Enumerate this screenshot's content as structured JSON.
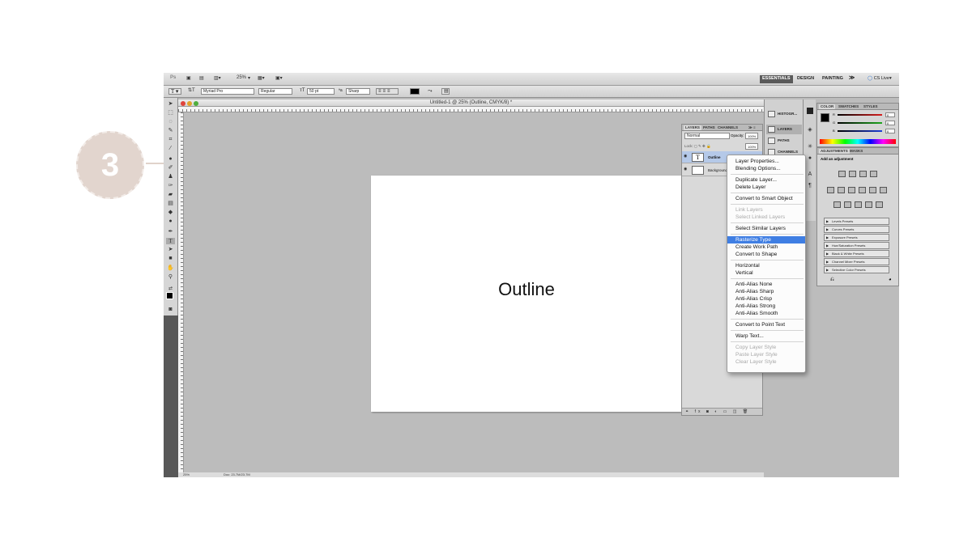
{
  "step": {
    "number": "3"
  },
  "appbar": {
    "app_logo": "Ps",
    "zoom": "25%",
    "workspaces": [
      "ESSENTIALS",
      "DESIGN",
      "PAINTING"
    ],
    "more": "≫",
    "cs_live": "CS Live"
  },
  "options_bar": {
    "font_family": "Myriad Pro",
    "font_style": "Regular",
    "font_size": "50 pt",
    "anti_alias": "Sharp"
  },
  "document": {
    "title": "Untitled-1 @ 25% (Outline, CMYK/8) *",
    "canvas_text": "Outline",
    "status_zoom": "25%",
    "status_doc": "Doc: 23.7M/23.7M"
  },
  "layers_panel": {
    "tabs": [
      "LAYERS",
      "PATHS",
      "CHANNELS"
    ],
    "blend_mode": "Normal",
    "opacity_label": "Opacity:",
    "opacity_value": "100%",
    "fill_value": "100%",
    "layers": [
      {
        "name": "Outline",
        "thumb": "T",
        "selected": true
      },
      {
        "name": "Background",
        "thumb": "",
        "selected": false
      }
    ]
  },
  "dock": {
    "items": [
      "HISTOGR...",
      "LAYERS",
      "PATHS",
      "CHANNELS"
    ]
  },
  "color_panel": {
    "tabs": [
      "COLOR",
      "SWATCHES",
      "STYLES"
    ],
    "channels": [
      {
        "label": "R",
        "value": "0",
        "color": "#d81e1e"
      },
      {
        "label": "G",
        "value": "0",
        "color": "#1ea81e"
      },
      {
        "label": "B",
        "value": "0",
        "color": "#1e3ed8"
      }
    ]
  },
  "adjustments_panel": {
    "tabs": [
      "ADJUSTMENTS",
      "MASKS"
    ],
    "heading": "Add an adjustment",
    "presets": [
      "Levels Presets",
      "Curves Presets",
      "Exposure Presets",
      "Hue/Saturation Presets",
      "Black & White Presets",
      "Channel Mixer Presets",
      "Selective Color Presets"
    ]
  },
  "context_menu": {
    "groups": [
      [
        {
          "label": "Layer Properties...",
          "disabled": false
        },
        {
          "label": "Blending Options...",
          "disabled": false
        }
      ],
      [
        {
          "label": "Duplicate Layer...",
          "disabled": false
        },
        {
          "label": "Delete Layer",
          "disabled": false
        }
      ],
      [
        {
          "label": "Convert to Smart Object",
          "disabled": false
        }
      ],
      [
        {
          "label": "Link Layers",
          "disabled": true
        },
        {
          "label": "Select Linked Layers",
          "disabled": true
        }
      ],
      [
        {
          "label": "Select Similar Layers",
          "disabled": false
        }
      ],
      [
        {
          "label": "Rasterize Type",
          "disabled": false,
          "highlighted": true
        },
        {
          "label": "Create Work Path",
          "disabled": false
        },
        {
          "label": "Convert to Shape",
          "disabled": false
        }
      ],
      [
        {
          "label": "Horizontal",
          "disabled": false
        },
        {
          "label": "Vertical",
          "disabled": false
        }
      ],
      [
        {
          "label": "Anti-Alias None",
          "disabled": false
        },
        {
          "label": "Anti-Alias Sharp",
          "disabled": false
        },
        {
          "label": "Anti-Alias Crisp",
          "disabled": false
        },
        {
          "label": "Anti-Alias Strong",
          "disabled": false
        },
        {
          "label": "Anti-Alias Smooth",
          "disabled": false
        }
      ],
      [
        {
          "label": "Convert to Point Text",
          "disabled": false
        }
      ],
      [
        {
          "label": "Warp Text...",
          "disabled": false
        }
      ],
      [
        {
          "label": "Copy Layer Style",
          "disabled": true
        },
        {
          "label": "Paste Layer Style",
          "disabled": true
        },
        {
          "label": "Clear Layer Style",
          "disabled": true
        }
      ]
    ]
  }
}
